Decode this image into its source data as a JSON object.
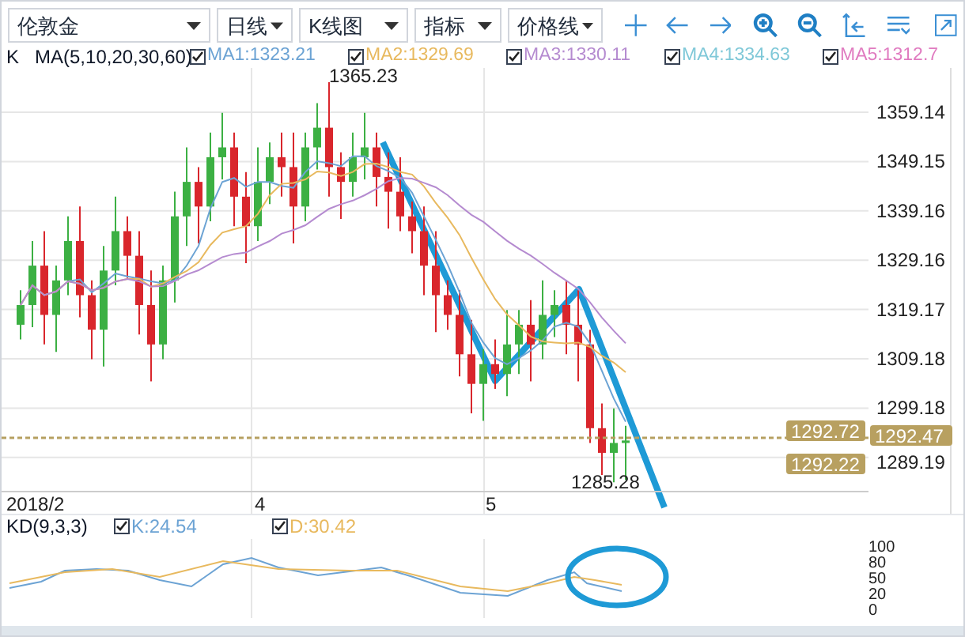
{
  "toolbar": {
    "dropdowns": [
      {
        "label": "伦敦金"
      },
      {
        "label": "日线"
      },
      {
        "label": "K线图"
      },
      {
        "label": "指标"
      },
      {
        "label": "价格线"
      }
    ]
  },
  "legend": {
    "prefix": "K",
    "indicator": "MA(5,10,20,30,60)",
    "items": [
      {
        "label": "MA1:1323.21",
        "checked": true,
        "color": "#6ca3d4"
      },
      {
        "label": "MA2:1329.69",
        "checked": true,
        "color": "#e8b95e"
      },
      {
        "label": "MA3:1330.11",
        "checked": true,
        "color": "#b58bd0"
      },
      {
        "label": "MA4:1334.63",
        "checked": true,
        "color": "#7fc8d8"
      },
      {
        "label": "MA5:1312.7",
        "checked": true,
        "color": "#e07bc0"
      }
    ]
  },
  "price_chart": {
    "high_label": "1365.23",
    "low_label": "1285.28",
    "y_ticks": [
      "1359.14",
      "1349.15",
      "1339.16",
      "1329.16",
      "1319.17",
      "1309.18",
      "1299.18",
      "1289.19"
    ],
    "price_tags": [
      {
        "label": "1292.72",
        "kind": "upper"
      },
      {
        "label": "1292.47",
        "kind": "axis"
      },
      {
        "label": "1292.22",
        "kind": "lower"
      }
    ]
  },
  "x_axis": [
    "2018/2",
    "4",
    "5"
  ],
  "kd": {
    "indicator": "KD(9,3,3)",
    "items": [
      {
        "label": "K:24.54",
        "checked": true,
        "color": "#6ca3d4"
      },
      {
        "label": "D:30.42",
        "checked": true,
        "color": "#e8b95e"
      }
    ],
    "y_ticks": [
      "100",
      "80",
      "50",
      "20",
      "0"
    ]
  }
}
